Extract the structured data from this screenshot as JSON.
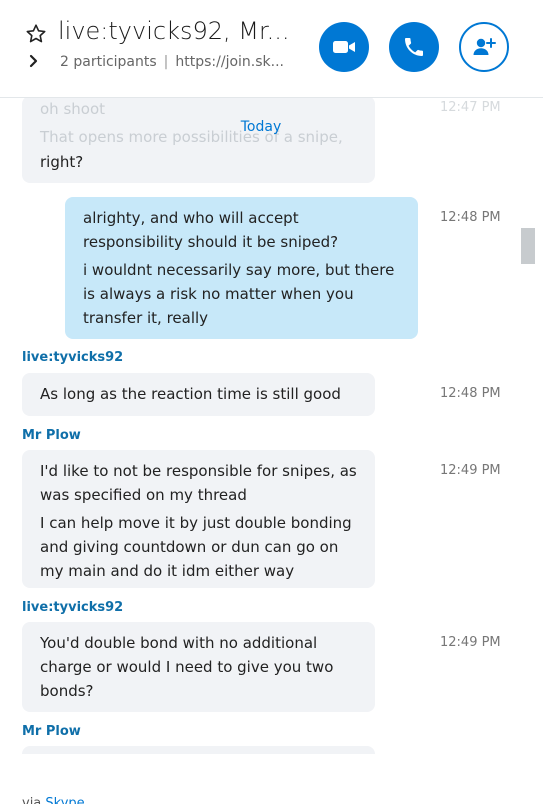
{
  "header": {
    "title": "live:tyvicks92, Mr...",
    "participants": "2 participants",
    "separator": "|",
    "link": "https://join.sk...",
    "video_icon": "video-camera-icon",
    "call_icon": "phone-icon",
    "add_icon": "add-person-icon",
    "accent_color": "#0078d4"
  },
  "date_divider": "Today",
  "faded_message": {
    "line1": "oh shoot",
    "line2": "That opens more possibilities of a snipe,",
    "line3": "right?",
    "time": "12:47 PM"
  },
  "messages": [
    {
      "sender": "",
      "lines": [
        "alrighty, and who will accept responsibility should it be sniped?",
        "i wouldnt necessarily say more, but there is always a risk no matter when you transfer it, really"
      ],
      "time": "12:48 PM",
      "mine": true
    },
    {
      "sender": "live:tyvicks92",
      "lines": [
        "As long as the reaction time is still good"
      ],
      "time": "12:48 PM"
    },
    {
      "sender": "Mr Plow",
      "lines": [
        "I'd like to not be responsible for snipes, as was specified on my thread",
        "I can help move it by just double bonding and giving countdown or dun can go on my main and do it idm either way"
      ],
      "time": "12:49 PM"
    },
    {
      "sender": "live:tyvicks92",
      "lines": [
        "You'd double bond with no additional charge or would I need to give you two bonds?"
      ],
      "time": "12:49 PM"
    },
    {
      "sender": "Mr Plow",
      "lines": [],
      "time": ""
    }
  ],
  "footer": {
    "prefix": "via",
    "link": "Skype"
  }
}
